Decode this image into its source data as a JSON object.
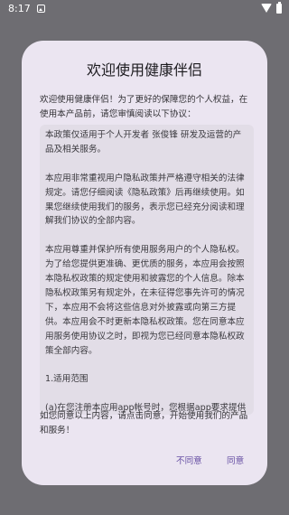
{
  "status_bar": {
    "time": "8:17",
    "notification_icon": "notification-icon",
    "wifi_icon": "wifi-icon",
    "battery_icon": "battery-icon"
  },
  "dialog": {
    "title": "欢迎使用健康伴侣",
    "intro": "欢迎使用健康伴侣！为了更好的保障您的个人权益，在使用本产品前，请您审慎阅读以下协议：",
    "policy_paragraphs": [
      "本政策仅适用于个人开发者 张俊锋 研发及运营的产品及相关服务。",
      "本应用非常重视用户隐私政策并严格遵守相关的法律规定。请您仔细阅读《隐私政策》后再继续使用。如果您继续使用我们的服务，表示您已经充分阅读和理解我们协议的全部内容。",
      "本应用尊重并保护所有使用服务用户的个人隐私权。为了给您提供更准确、更优质的服务，本应用会按照本隐私权政策的规定使用和披露您的个人信息。除本隐私权政策另有规定外，在未征得您事先许可的情况下，本应用不会将这些信息对外披露或向第三方提供。本应用会不时更新本隐私权政策。您在同意本应用服务使用协议之时，即视为您已经同意本隐私权政策全部内容。",
      "1.适用范围",
      "(a)在您注册本应用app帐号时，您根据app要求提供的个人注册信息；"
    ],
    "outro": "如您同意以上内容，请点击同意，开始使用我们的产品和服务！",
    "disagree_label": "不同意",
    "agree_label": "同意"
  },
  "colors": {
    "scrim": "#6e6d72",
    "dialog_bg": "#ebe5f1",
    "scroll_bg": "#e2dde7",
    "accent": "#6750a4"
  }
}
